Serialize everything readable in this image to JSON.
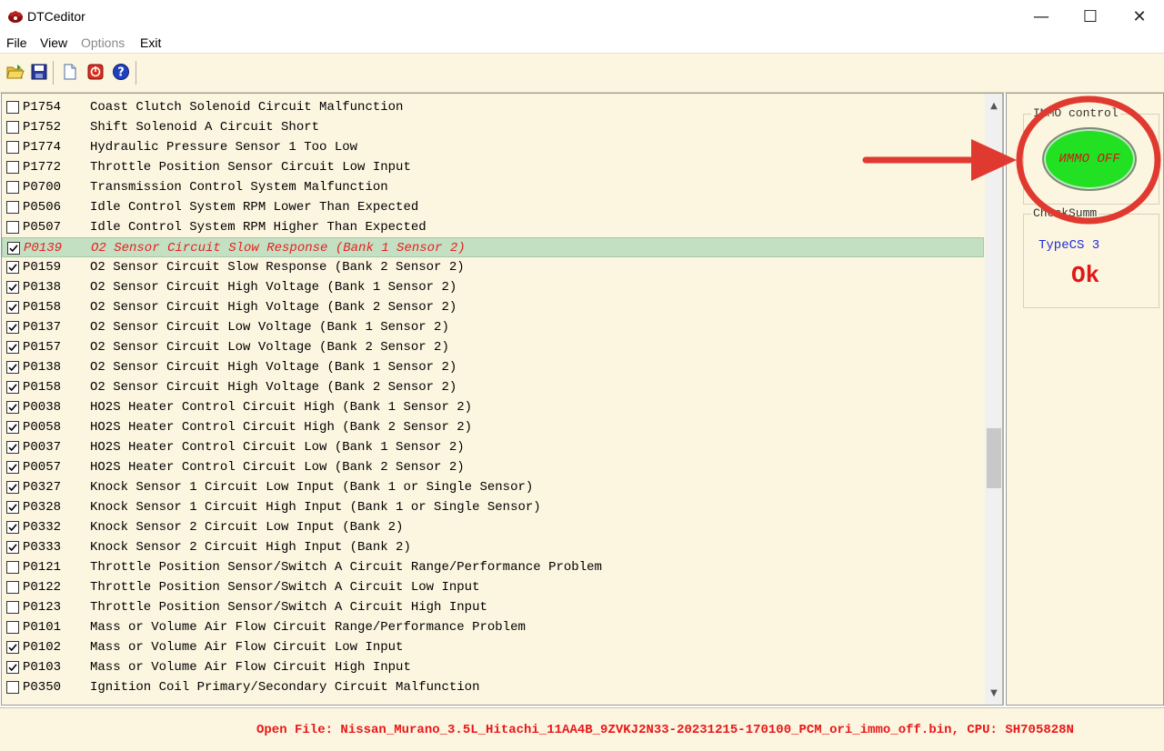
{
  "window": {
    "title": "DTCeditor",
    "controls": {
      "minimize": "—",
      "maximize": "☐",
      "close": "✕"
    }
  },
  "menu": {
    "items": [
      {
        "label": "File",
        "enabled": true
      },
      {
        "label": "View",
        "enabled": true
      },
      {
        "label": "Options",
        "enabled": false
      },
      {
        "label": "Exit",
        "enabled": true
      }
    ]
  },
  "toolbar": {
    "icons": [
      "open-folder-icon",
      "save-icon",
      "new-document-icon",
      "stop-icon",
      "help-icon"
    ]
  },
  "dtc_list": {
    "rows": [
      {
        "code": "P1754",
        "desc": "Coast Clutch Solenoid Circuit Malfunction",
        "checked": false
      },
      {
        "code": "P1752",
        "desc": "Shift Solenoid A Circuit Short",
        "checked": false
      },
      {
        "code": "P1774",
        "desc": "Hydraulic Pressure Sensor 1 Too Low",
        "checked": false
      },
      {
        "code": "P1772",
        "desc": "Throttle Position Sensor Circuit Low Input",
        "checked": false
      },
      {
        "code": "P0700",
        "desc": "Transmission Control System Malfunction",
        "checked": false
      },
      {
        "code": "P0506",
        "desc": "Idle Control System RPM Lower Than Expected",
        "checked": false
      },
      {
        "code": "P0507",
        "desc": "Idle Control System RPM Higher Than Expected",
        "checked": false
      },
      {
        "code": "P0139",
        "desc": "O2 Sensor Circuit Slow Response (Bank 1 Sensor 2)",
        "checked": true,
        "selected": true
      },
      {
        "code": "P0159",
        "desc": "O2 Sensor Circuit Slow Response (Bank 2 Sensor 2)",
        "checked": true
      },
      {
        "code": "P0138",
        "desc": "O2 Sensor Circuit High Voltage (Bank 1 Sensor 2)",
        "checked": true
      },
      {
        "code": "P0158",
        "desc": "O2 Sensor Circuit High Voltage (Bank 2 Sensor 2)",
        "checked": true
      },
      {
        "code": "P0137",
        "desc": "O2 Sensor Circuit Low Voltage (Bank 1 Sensor 2)",
        "checked": true
      },
      {
        "code": "P0157",
        "desc": "O2 Sensor Circuit Low Voltage (Bank 2 Sensor 2)",
        "checked": true
      },
      {
        "code": "P0138",
        "desc": "O2 Sensor Circuit High Voltage (Bank 1 Sensor 2)",
        "checked": true
      },
      {
        "code": "P0158",
        "desc": "O2 Sensor Circuit High Voltage (Bank 2 Sensor 2)",
        "checked": true
      },
      {
        "code": "P0038",
        "desc": "HO2S Heater Control Circuit High (Bank 1 Sensor 2)",
        "checked": true
      },
      {
        "code": "P0058",
        "desc": "HO2S Heater Control Circuit High (Bank 2 Sensor 2)",
        "checked": true
      },
      {
        "code": "P0037",
        "desc": "HO2S Heater Control Circuit Low (Bank 1 Sensor 2)",
        "checked": true
      },
      {
        "code": "P0057",
        "desc": "HO2S Heater Control Circuit Low (Bank 2 Sensor 2)",
        "checked": true
      },
      {
        "code": "P0327",
        "desc": "Knock Sensor 1 Circuit Low Input (Bank 1 or Single Sensor)",
        "checked": true
      },
      {
        "code": "P0328",
        "desc": "Knock Sensor 1 Circuit High Input (Bank 1 or Single Sensor)",
        "checked": true
      },
      {
        "code": "P0332",
        "desc": "Knock Sensor 2 Circuit Low Input (Bank 2)",
        "checked": true
      },
      {
        "code": "P0333",
        "desc": "Knock Sensor 2 Circuit High Input (Bank 2)",
        "checked": true
      },
      {
        "code": "P0121",
        "desc": "Throttle Position Sensor/Switch A Circuit Range/Performance Problem",
        "checked": false
      },
      {
        "code": "P0122",
        "desc": "Throttle Position Sensor/Switch A Circuit Low Input",
        "checked": false
      },
      {
        "code": "P0123",
        "desc": "Throttle Position Sensor/Switch A Circuit High Input",
        "checked": false
      },
      {
        "code": "P0101",
        "desc": "Mass or Volume Air Flow Circuit Range/Performance Problem",
        "checked": false
      },
      {
        "code": "P0102",
        "desc": "Mass or Volume Air Flow Circuit Low Input",
        "checked": true
      },
      {
        "code": "P0103",
        "desc": "Mass or Volume Air Flow Circuit High Input",
        "checked": true
      },
      {
        "code": "P0350",
        "desc": "Ignition Coil Primary/Secondary Circuit Malfunction",
        "checked": false
      }
    ]
  },
  "side_panel": {
    "immo_title": "IMMO control",
    "immo_button": "ИММО OFF",
    "checksum_title": "CheckSumm",
    "type_cs": "TypeCS 3",
    "checksum_status": "Ok"
  },
  "status_bar": {
    "text": "Open File: Nissan_Murano_3.5L_Hitachi_11AA4B_9ZVKJ2N33-20231215-170100_PCM_ori_immo_off.bin, CPU: SH705828N"
  },
  "colors": {
    "panel_bg": "#fcf5e0",
    "selected_row": "#c3e0c3",
    "immo_green": "#22e022",
    "alert_red": "#e81818",
    "type_blue": "#1e2ed6",
    "annotation_red": "#e03a30"
  }
}
